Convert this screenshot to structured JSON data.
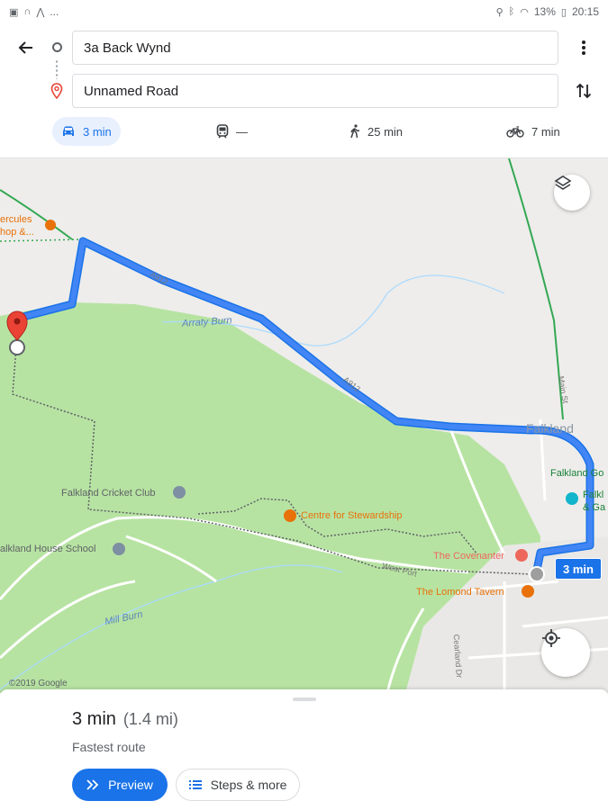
{
  "status_bar": {
    "left_icons": [
      "image-icon",
      "headset-icon",
      "maps-icon"
    ],
    "left_more": "...",
    "battery_percent": "13%",
    "time": "20:15"
  },
  "directions": {
    "origin_value": "3a Back Wynd",
    "destination_value": "Unnamed Road",
    "modes": {
      "drive": "3 min",
      "transit": "—",
      "walk": "25 min",
      "bike": "7 min"
    }
  },
  "map": {
    "labels": {
      "hercules_line1": "ercules",
      "hercules_line2": "hop &...",
      "arraty_burn": "Arraty Burn",
      "road_a912_a": "A912",
      "road_a912_b": "A912",
      "falkland": "Falkland",
      "falkland_go": "Falkland Go",
      "falkland_g1": "Falkl",
      "falkland_g2": "& Ga",
      "cricket_club": "Falkland Cricket Club",
      "centre_stewardship": "Centre for Stewardship",
      "house_school": "alkland House School",
      "covenanter": "The Covenanter",
      "lomond_tavern": "The Lomond Tavern",
      "mill_burn": "Mill Burn",
      "main_st": "Main St",
      "west_port": "West Port",
      "cearland_dr": "Cearland Dr"
    },
    "duration_badge": "3 min",
    "copyright": "©2019 Google"
  },
  "sheet": {
    "time": "3 min",
    "distance": "(1.4 mi)",
    "description": "Fastest route",
    "preview_label": "Preview",
    "steps_label": "Steps & more"
  },
  "colors": {
    "route": "#4285f4",
    "accent": "#1a73e8",
    "park": "#b7e3a2",
    "land": "#eeedeb",
    "pin": "#ea4335"
  }
}
